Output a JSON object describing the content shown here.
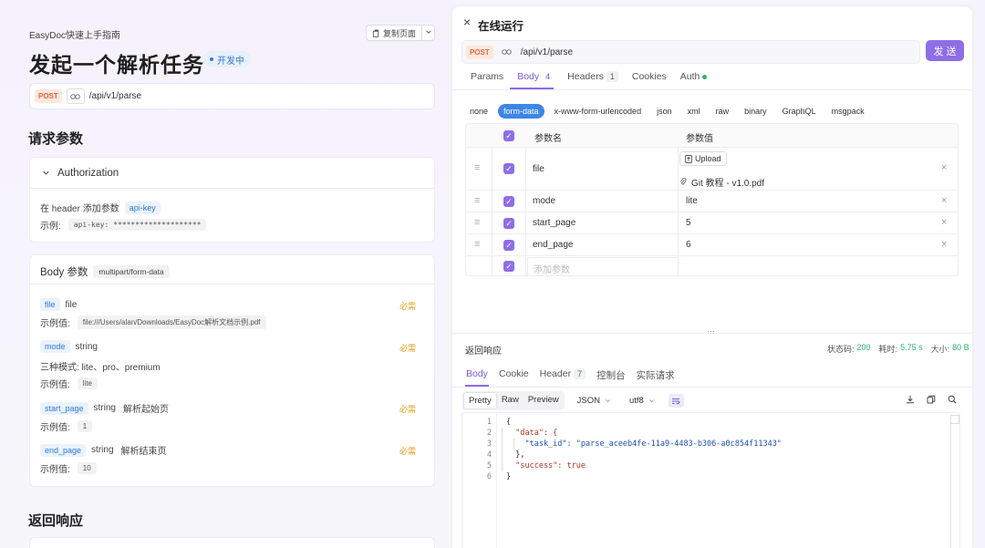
{
  "left": {
    "breadcrumb": "EasyDoc快速上手指南",
    "copy_label": "复制页面",
    "title": "发起一个解析任务",
    "status_badge": "开发中",
    "method": "POST",
    "url": "/api/v1/parse",
    "request_params_heading": "请求参数",
    "auth": {
      "title": "Authorization",
      "desc_prefix": "在 header 添加参数",
      "param": "api-key",
      "example_label": "示例:",
      "example_value": "api-key: ********************"
    },
    "body": {
      "title": "Body 参数",
      "content_type": "multipart/form-data",
      "params": [
        {
          "name": "file",
          "type": "file",
          "desc": "",
          "required": "必需",
          "extra": "",
          "example_label": "示例值:",
          "example": "file:///Users/alan/Downloads/EasyDoc解析文档示例.pdf"
        },
        {
          "name": "mode",
          "type": "string",
          "desc": "",
          "required": "必需",
          "extra": "三种模式: lite、pro、premium",
          "example_label": "示例值:",
          "example": "lite"
        },
        {
          "name": "start_page",
          "type": "string",
          "desc": "解析起始页",
          "required": "必需",
          "extra": "",
          "example_label": "示例值:",
          "example": "1"
        },
        {
          "name": "end_page",
          "type": "string",
          "desc": "解析结束页",
          "required": "必需",
          "extra": "",
          "example_label": "示例值:",
          "example": "10"
        }
      ]
    },
    "response_heading": "返回响应"
  },
  "right": {
    "close": "×",
    "title": "在线运行",
    "method": "POST",
    "url": "/api/v1/parse",
    "send_label": "发 送",
    "tabs": [
      {
        "label": "Params",
        "count": ""
      },
      {
        "label": "Body",
        "count": "4"
      },
      {
        "label": "Headers",
        "count": "1"
      },
      {
        "label": "Cookies",
        "count": ""
      },
      {
        "label": "Auth",
        "count": ""
      }
    ],
    "body_types": [
      "none",
      "form-data",
      "x-www-form-urlencoded",
      "json",
      "xml",
      "raw",
      "binary",
      "GraphQL",
      "msgpack"
    ],
    "table": {
      "col_name": "参数名",
      "col_value": "参数值",
      "upload_label": "Upload",
      "file_name": "Git 教程 - v1.0.pdf",
      "rows": [
        {
          "name": "file",
          "value": ""
        },
        {
          "name": "mode",
          "value": "lite"
        },
        {
          "name": "start_page",
          "value": "5"
        },
        {
          "name": "end_page",
          "value": "6"
        }
      ],
      "add_placeholder": "添加参数"
    },
    "divider_handle": "···",
    "response": {
      "title": "返回响应",
      "status_label": "状态码:",
      "status_value": "200",
      "time_label": "耗时:",
      "time_value": "5.75 s",
      "size_label": "大小:",
      "size_value": "80 B",
      "tabs": [
        {
          "label": "Body",
          "count": ""
        },
        {
          "label": "Cookie",
          "count": ""
        },
        {
          "label": "Header",
          "count": "7"
        },
        {
          "label": "控制台",
          "count": ""
        },
        {
          "label": "实际请求",
          "count": ""
        }
      ],
      "formats": [
        "Pretty",
        "Raw",
        "Preview"
      ],
      "lang": "JSON",
      "encoding": "utf8",
      "code_lines": [
        {
          "n": "1",
          "t": "{"
        },
        {
          "n": "2",
          "t": "  \"data\": {"
        },
        {
          "n": "3",
          "t": "    \"task_id\": \"parse_aceeb4fe-11a9-4483-b306-a0c854f11343\""
        },
        {
          "n": "4",
          "t": "  },"
        },
        {
          "n": "5",
          "t": "  \"success\": true"
        },
        {
          "n": "6",
          "t": "}"
        }
      ]
    }
  }
}
